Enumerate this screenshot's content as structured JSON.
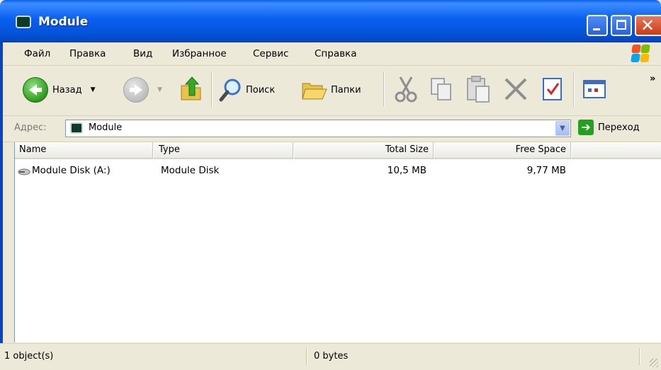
{
  "window": {
    "title": "Module"
  },
  "menu": [
    {
      "label": "Файл"
    },
    {
      "label": "Правка"
    },
    {
      "label": "Вид"
    },
    {
      "label": "Избранное"
    },
    {
      "label": "Сервис"
    },
    {
      "label": "Справка"
    }
  ],
  "toolbar": {
    "back_label": "Назад",
    "search_label": "Поиск",
    "folders_label": "Папки",
    "overflow": "»"
  },
  "address": {
    "label": "Адрес:",
    "value": "Module",
    "go_label": "Переход"
  },
  "list": {
    "columns": [
      "Name",
      "Type",
      "Total Size",
      "Free Space"
    ],
    "rows": [
      {
        "name": "Module Disk (A:)",
        "type": "Module Disk",
        "total_size": "10,5 MB",
        "free_space": "9,77 MB"
      }
    ]
  },
  "status": {
    "objects": "1 object(s)",
    "size": "0 bytes"
  },
  "colors": {
    "titlebar": "#0a5ff0",
    "close_button": "#c83c18",
    "go_arrow": "#23a020"
  }
}
